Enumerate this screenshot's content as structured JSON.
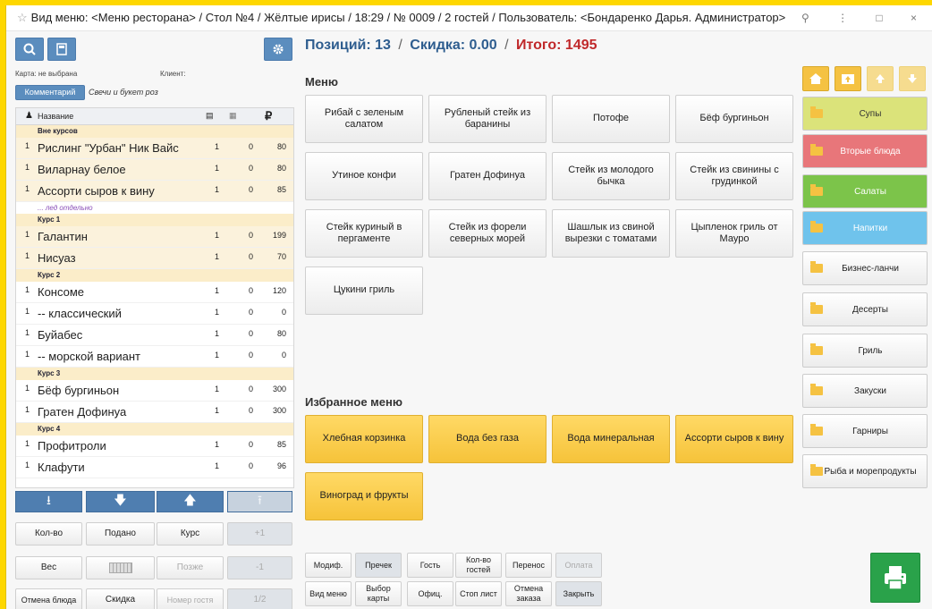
{
  "titlebar": {
    "text": "Вид меню: <Меню ресторана> / Стол №4 / Жёлтые ирисы / 18:29 / № 0009 / 2 гостей / Пользователь: <Бондаренко Дарья. Администратор>",
    "controls": "⚲ ⋮ □ ×"
  },
  "summary": {
    "positions": "Позиций: 13",
    "sep1": "/",
    "discount": "Скидка: 0.00",
    "sep2": "/",
    "total": "Итого: 1495"
  },
  "left": {
    "card": "Карта: не выбрана",
    "client": "Клиент:",
    "comment_btn": "Комментарий",
    "comment_text": "Свечи и букет роз",
    "columns": {
      "name": "Название",
      "currency": "₽"
    },
    "rows": [
      {
        "type": "course",
        "label": "Вне курсов"
      },
      {
        "type": "item",
        "n": "1",
        "name": "Рислинг \"Урбан\" Ник Вайс",
        "q": "1",
        "d": "0",
        "p": "80",
        "hl": true
      },
      {
        "type": "item",
        "n": "1",
        "name": "Виларнау белое",
        "q": "1",
        "d": "0",
        "p": "80",
        "hl": true
      },
      {
        "type": "item",
        "n": "1",
        "name": "Ассорти сыров к вину",
        "q": "1",
        "d": "0",
        "p": "85",
        "hl": true
      },
      {
        "type": "note",
        "label": "... лед отдельно"
      },
      {
        "type": "course",
        "label": "Курс 1"
      },
      {
        "type": "item",
        "n": "1",
        "name": "Галантин",
        "q": "1",
        "d": "0",
        "p": "199",
        "hl": true
      },
      {
        "type": "item",
        "n": "1",
        "name": "Нисуаз",
        "q": "1",
        "d": "0",
        "p": "70",
        "hl": true
      },
      {
        "type": "course",
        "label": "Курс 2"
      },
      {
        "type": "item",
        "n": "1",
        "name": "Консоме",
        "q": "1",
        "d": "0",
        "p": "120",
        "hl": false
      },
      {
        "type": "item",
        "n": "1",
        "name": "-- классический",
        "q": "1",
        "d": "0",
        "p": "0",
        "hl": false
      },
      {
        "type": "item",
        "n": "1",
        "name": "Буйабес",
        "q": "1",
        "d": "0",
        "p": "80",
        "hl": false
      },
      {
        "type": "item",
        "n": "1",
        "name": "-- морской вариант",
        "q": "1",
        "d": "0",
        "p": "0",
        "hl": false
      },
      {
        "type": "course",
        "label": "Курс 3"
      },
      {
        "type": "item",
        "n": "1",
        "name": "Бёф бургиньон",
        "q": "1",
        "d": "0",
        "p": "300",
        "hl": false
      },
      {
        "type": "item",
        "n": "1",
        "name": "Гратен Дофинуа",
        "q": "1",
        "d": "0",
        "p": "300",
        "hl": false
      },
      {
        "type": "course",
        "label": "Курс 4"
      },
      {
        "type": "item",
        "n": "1",
        "name": "Профитроли",
        "q": "1",
        "d": "0",
        "p": "85",
        "hl": false
      },
      {
        "type": "item",
        "n": "1",
        "name": "Клафути",
        "q": "1",
        "d": "0",
        "p": "96",
        "hl": false
      }
    ],
    "actions_row1": [
      "Кол-во",
      "Подано",
      "Курс",
      "+1"
    ],
    "actions_row2": [
      "Вес",
      "",
      "Позже",
      "-1"
    ],
    "actions_row3": [
      "Отмена блюда",
      "Скидка",
      "Номер гостя",
      "1/2"
    ]
  },
  "menu": {
    "label": "Меню",
    "items": [
      "Рибай с зеленым салатом",
      "Рубленый стейк из баранины",
      "Потофе",
      "Бёф бургиньон",
      "Утиное конфи",
      "Гратен Дофинуа",
      "Стейк из молодого бычка",
      "Стейк из свинины с грудинкой",
      "Стейк куриный в пергаменте",
      "Стейк из форели северных морей",
      "Шашлык из свиной вырезки с томатами",
      "Цыпленок гриль от Мауро",
      "Цукини гриль"
    ]
  },
  "favorites": {
    "label": "Избранное меню",
    "items": [
      "Хлебная корзинка",
      "Вода без газа",
      "Вода минеральная",
      "Ассорти сыров к вину",
      "Виноград и фрукты"
    ]
  },
  "categories": [
    {
      "label": "Супы",
      "color": "#dbe37a"
    },
    {
      "label": "Вторые блюда",
      "color": "#e8767a"
    },
    {
      "label": "Салаты",
      "color": "#7cc44a"
    },
    {
      "label": "Напитки",
      "color": "#6fc3ec"
    },
    {
      "label": "Бизнес-ланчи",
      "color": "#f4f4f4"
    },
    {
      "label": "Десерты",
      "color": "#f4f4f4"
    },
    {
      "label": "Гриль",
      "color": "#f4f4f4"
    },
    {
      "label": "Закуски",
      "color": "#f4f4f4"
    },
    {
      "label": "Гарниры",
      "color": "#f4f4f4"
    },
    {
      "label": "Рыба и морепродукты",
      "color": "#f4f4f4"
    }
  ],
  "bottom_row1": [
    "Модиф.",
    "Пречек",
    "Гость",
    "Кол-во гостей",
    "Перенос",
    "Оплата"
  ],
  "bottom_row2": [
    "Вид меню",
    "Выбор карты",
    "Офиц.",
    "Стоп лист",
    "Отмена заказа",
    "Закрыть"
  ]
}
